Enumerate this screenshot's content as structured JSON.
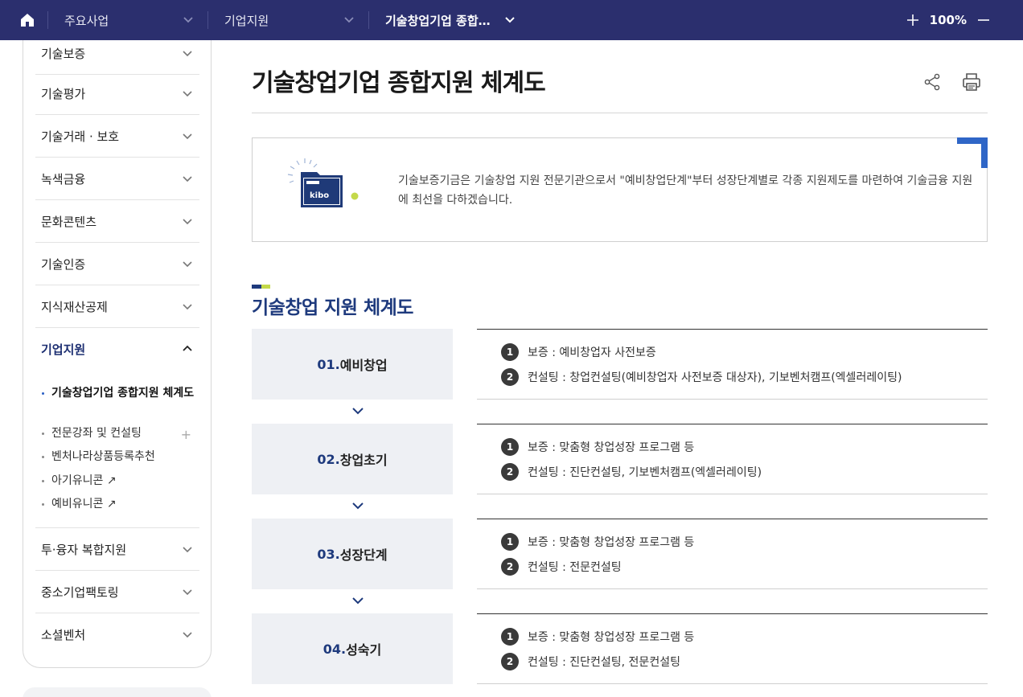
{
  "topbar": {
    "crumbs": [
      "주요사업",
      "기업지원",
      "기술창업기업 종합…"
    ],
    "zoom": "100%"
  },
  "sidebar": {
    "items": [
      "기술보증",
      "기술평가",
      "기술거래 · 보호",
      "녹색금융",
      "문화콘텐츠",
      "기술인증",
      "지식재산공제",
      "기업지원",
      "투·융자 복합지원",
      "중소기업팩토링",
      "소셜벤처"
    ],
    "open_item": "기업지원",
    "sub_items": [
      "기술창업기업 종합지원 체계도",
      "전문강좌 및 컨설팅",
      "벤처나라상품등록추천",
      "아기유니콘 ↗",
      "예비유니콘 ↗"
    ],
    "sub_plus": "+"
  },
  "page": {
    "title": "기술창업기업 종합지원 체계도",
    "intro_text": "기술보증기금은 기술창업 지원 전문기관으로서 \"예비창업단계\"부터 성장단계별로 각종 지원제도를 마련하여 기술금융 지원에 최선을 다하겠습니다.",
    "logo_text": "kibo",
    "section_title": "기술창업 지원 체계도"
  },
  "stages": [
    {
      "num": "01.",
      "name": "예비창업",
      "lines": [
        {
          "n": "1",
          "text": "보증 : 예비창업자 사전보증"
        },
        {
          "n": "2",
          "text": "컨설팅 : 창업컨설팅(예비창업자 사전보증 대상자), 기보벤처캠프(엑셀러레이팅)"
        }
      ]
    },
    {
      "num": "02.",
      "name": "창업초기",
      "lines": [
        {
          "n": "1",
          "text": "보증 : 맞춤형 창업성장 프로그램 등"
        },
        {
          "n": "2",
          "text": "컨설팅 : 진단컨설팅, 기보벤처캠프(엑셀러레이팅)"
        }
      ]
    },
    {
      "num": "03.",
      "name": "성장단계",
      "lines": [
        {
          "n": "1",
          "text": "보증 : 맞춤형 창업성장 프로그램 등"
        },
        {
          "n": "2",
          "text": "컨설팅 : 전문컨설팅"
        }
      ]
    },
    {
      "num": "04.",
      "name": "성숙기",
      "lines": [
        {
          "n": "1",
          "text": "보증 : 맞춤형 창업성장 프로그램 등"
        },
        {
          "n": "2",
          "text": "컨설팅 : 진단컨설팅, 전문컨설팅"
        }
      ]
    }
  ],
  "colors": {
    "topbar": "#2b2f6e",
    "accent_blue": "#2f66c7",
    "section_blue": "#1e3a7d",
    "accent_green": "#c4d94a"
  }
}
